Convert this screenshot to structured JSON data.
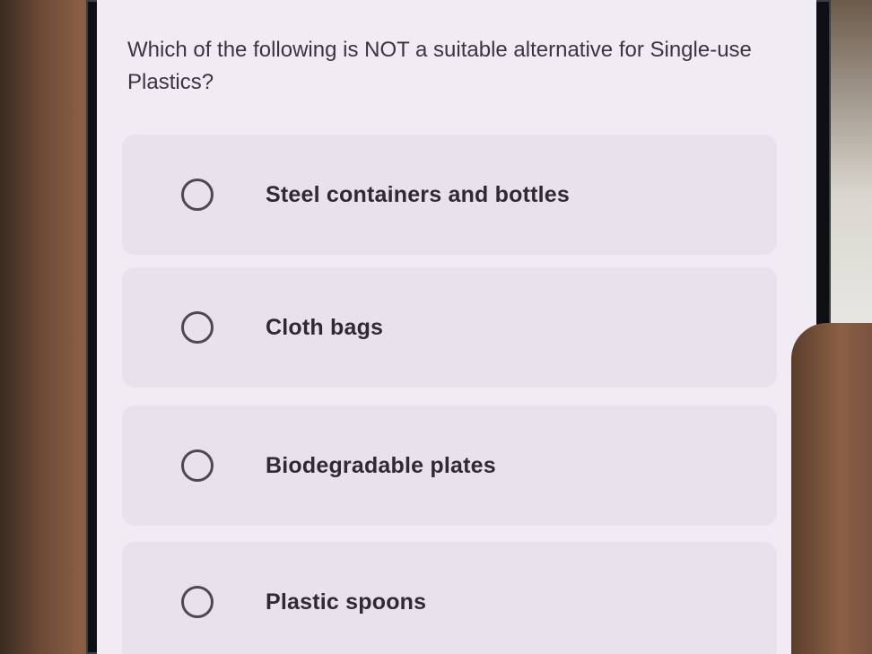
{
  "quiz": {
    "question": "Which of the following is NOT a suitable alternative for Single-use Plastics?",
    "options": [
      {
        "label": "Steel containers and bottles",
        "selected": false
      },
      {
        "label": "Cloth bags",
        "selected": false
      },
      {
        "label": "Biodegradable plates",
        "selected": false
      },
      {
        "label": "Plastic spoons",
        "selected": false
      }
    ]
  },
  "icons": {
    "radio": "radio-unchecked-icon"
  },
  "colors": {
    "screen_bg": "#f1ebf4",
    "option_bg": "#e9e1ec",
    "text": "#2f2a33"
  }
}
